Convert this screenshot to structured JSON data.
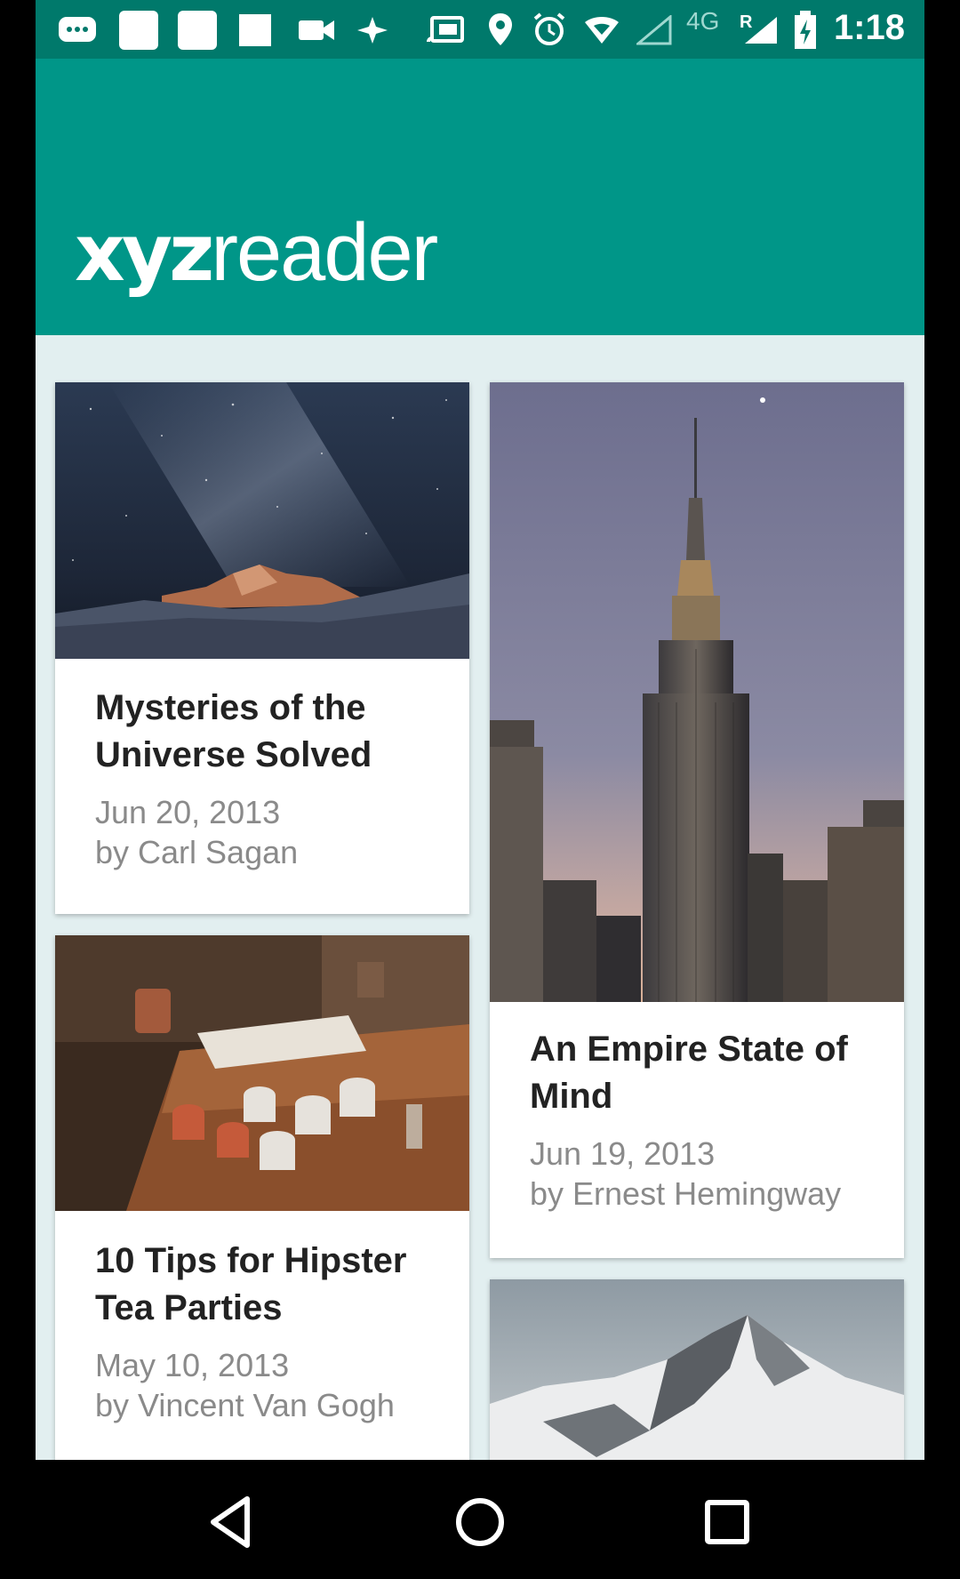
{
  "status_bar": {
    "time": "1:18",
    "network": "4G",
    "roaming": "R",
    "icons": [
      "messages-icon",
      "notification-icon",
      "notification-icon",
      "notification-icon",
      "video-icon",
      "app-icon",
      "cast-icon",
      "location-icon",
      "alarm-icon",
      "wifi-icon",
      "signal-icon",
      "signal-icon",
      "battery-charging-icon"
    ]
  },
  "app_bar": {
    "logo_bold": "xyz",
    "logo_light": "reader",
    "background": "#009688",
    "status_color": "#00796B"
  },
  "articles": [
    {
      "title": "Mysteries of the Universe Solved",
      "date": "Jun 20, 2013",
      "author": "by Carl Sagan",
      "image": "night-sky-mountain"
    },
    {
      "title": "An Empire State of Mind",
      "date": "Jun 19, 2013",
      "author": "by Ernest Hemingway",
      "image": "empire-state-building"
    },
    {
      "title": "10 Tips for Hipster Tea Parties",
      "date": "May 10, 2013",
      "author": "by Vincent Van Gogh",
      "image": "tea-cups-table"
    },
    {
      "title": "",
      "date": "",
      "author": "",
      "image": "snowy-mountain"
    }
  ],
  "nav_bar": {
    "icons": [
      "back-icon",
      "home-icon",
      "recents-icon"
    ]
  }
}
